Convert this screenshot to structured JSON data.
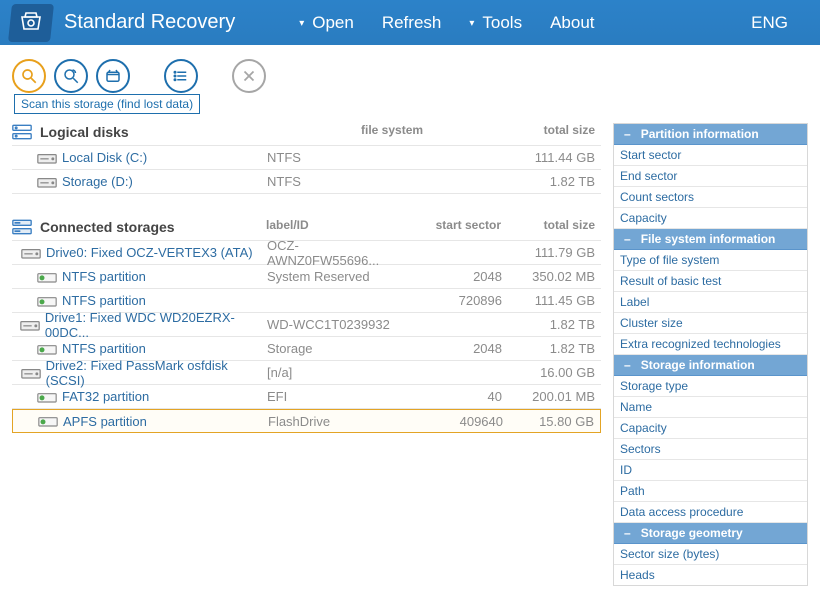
{
  "app": {
    "title": "Standard Recovery",
    "language": "ENG"
  },
  "menu": {
    "open": "Open",
    "refresh": "Refresh",
    "tools": "Tools",
    "about": "About"
  },
  "toolbar": {
    "tooltip": "Scan this storage (find lost data)"
  },
  "sections": {
    "logical": {
      "title": "Logical disks",
      "headers": {
        "fs": "file system",
        "size": "total size"
      },
      "rows": [
        {
          "name": "Local Disk (C:)",
          "fs": "NTFS",
          "size": "111.44 GB"
        },
        {
          "name": "Storage (D:)",
          "fs": "NTFS",
          "size": "1.82 TB"
        }
      ]
    },
    "connected": {
      "title": "Connected storages",
      "headers": {
        "label": "label/ID",
        "start": "start sector",
        "size": "total size"
      },
      "rows": [
        {
          "kind": "drive",
          "name": "Drive0: Fixed OCZ-VERTEX3 (ATA)",
          "label": "OCZ-AWNZ0FW55696...",
          "start": "",
          "size": "111.79 GB"
        },
        {
          "kind": "ntfs",
          "name": "NTFS partition",
          "label": "System Reserved",
          "start": "2048",
          "size": "350.02 MB"
        },
        {
          "kind": "ntfs",
          "name": "NTFS partition",
          "label": "",
          "start": "720896",
          "size": "111.45 GB"
        },
        {
          "kind": "drive",
          "name": "Drive1: Fixed WDC WD20EZRX-00DC...",
          "label": "WD-WCC1T0239932",
          "start": "",
          "size": "1.82 TB"
        },
        {
          "kind": "ntfs",
          "name": "NTFS partition",
          "label": "Storage",
          "start": "2048",
          "size": "1.82 TB"
        },
        {
          "kind": "drive",
          "name": "Drive2: Fixed PassMark osfdisk (SCSI)",
          "label": "[n/a]",
          "start": "",
          "size": "16.00 GB"
        },
        {
          "kind": "fat",
          "name": "FAT32 partition",
          "label": "EFI",
          "start": "40",
          "size": "200.01 MB"
        },
        {
          "kind": "apfs",
          "name": "APFS partition",
          "label": "FlashDrive",
          "start": "409640",
          "size": "15.80 GB",
          "selected": true
        }
      ]
    }
  },
  "panel": {
    "groups": [
      {
        "title": "Partition information",
        "props": [
          "Start sector",
          "End sector",
          "Count sectors",
          "Capacity"
        ]
      },
      {
        "title": "File system information",
        "props": [
          "Type of file system",
          "Result of basic test",
          "Label",
          "Cluster size",
          "Extra recognized technologies"
        ]
      },
      {
        "title": "Storage information",
        "props": [
          "Storage type",
          "Name",
          "Capacity",
          "Sectors",
          "ID",
          "Path",
          "Data access procedure"
        ]
      },
      {
        "title": "Storage geometry",
        "props": [
          "Sector size (bytes)",
          "Heads"
        ]
      }
    ]
  }
}
